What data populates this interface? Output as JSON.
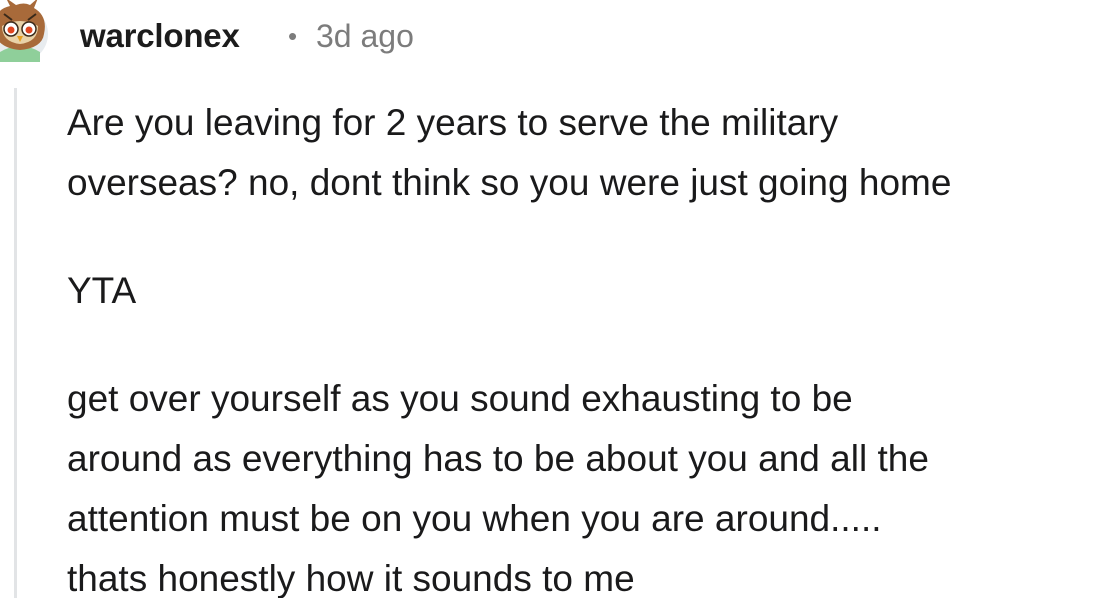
{
  "comment": {
    "author": "warclonex",
    "separator": "•",
    "age": "3d ago",
    "paragraphs": [
      [
        "Are you leaving for 2 years to serve the military",
        "overseas? no, dont think so you were just going home"
      ],
      [
        "YTA"
      ],
      [
        "get over yourself as you sound exhausting to be",
        "around as everything has to be about you and all the",
        "attention must be on you when you are around.....",
        "thats honestly how it sounds to me"
      ]
    ]
  },
  "colors": {
    "text": "#1a1a1b",
    "meta": "#7c7c7c",
    "thread_line": "#e2e4e6",
    "background": "#ffffff"
  }
}
